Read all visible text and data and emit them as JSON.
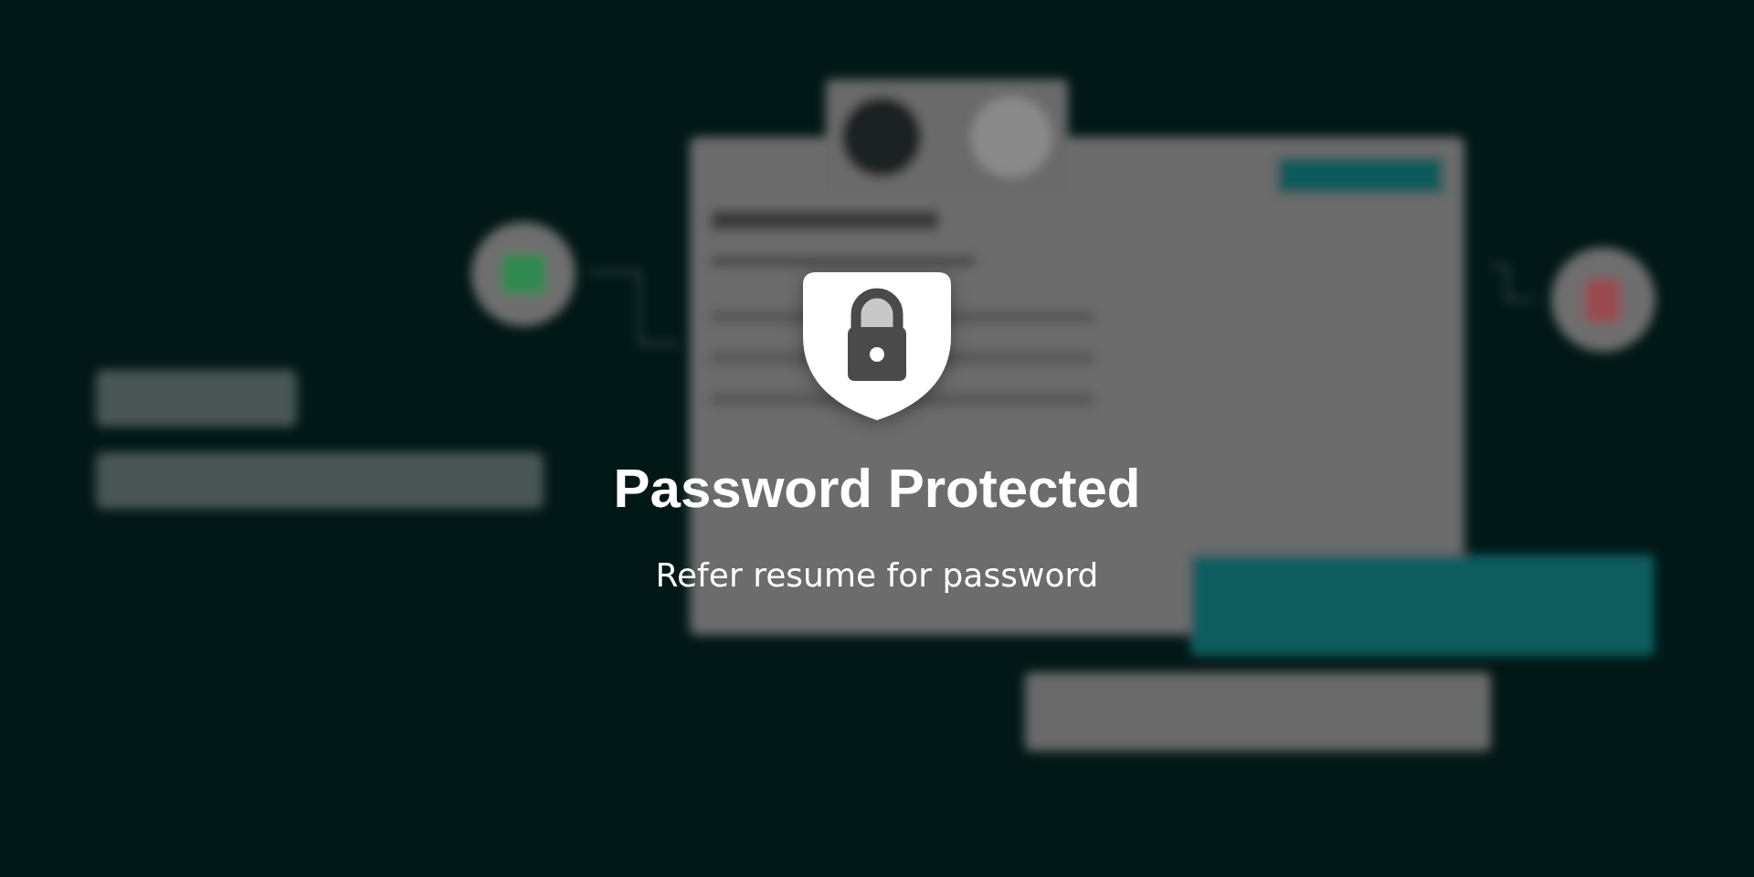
{
  "lock": {
    "title": "Password Protected",
    "message": "Refer resume for password"
  }
}
